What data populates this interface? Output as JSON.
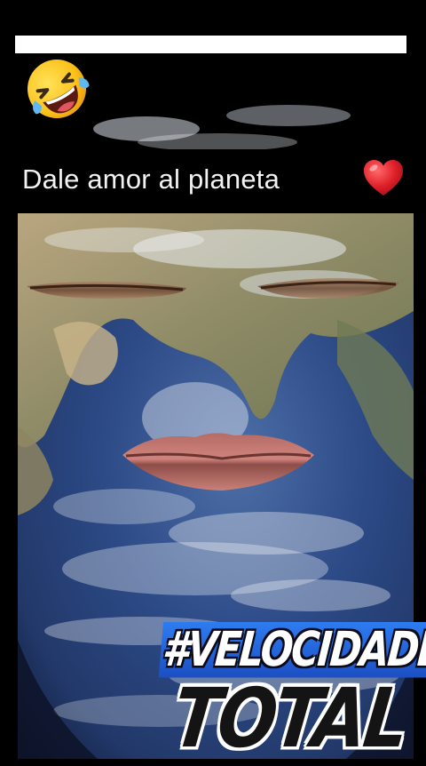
{
  "video": {
    "caption": "Dale amor al planeta",
    "caption_icon": "red-heart-icon",
    "reaction_icon": "rolling-laughing-face-icon"
  },
  "brand": {
    "line1": "#VELOCIDADE",
    "line2": "TOTAL",
    "accent_color": "#2a6ee8"
  },
  "colors": {
    "background": "#000000",
    "top_bar": "#ffffff",
    "caption_text": "#f2f2f2",
    "heart": "#e0202a"
  }
}
